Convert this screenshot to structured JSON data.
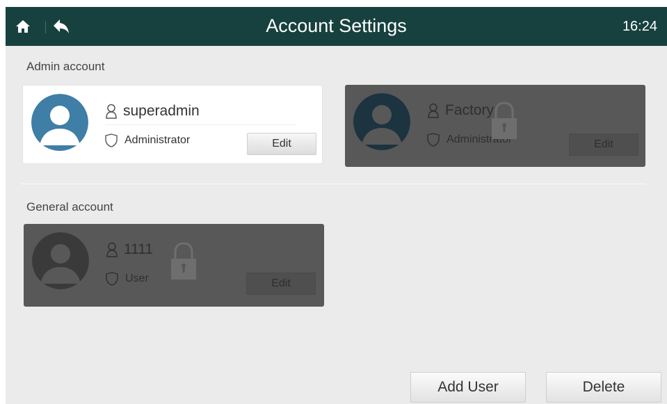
{
  "header": {
    "title": "Account Settings",
    "time": "16:24",
    "home_icon": "home-icon",
    "back_icon": "back-arrow-icon",
    "color": "#17413f"
  },
  "sections": {
    "admin_label": "Admin account",
    "general_label": "General account"
  },
  "admin_accounts": [
    {
      "name": "superadmin",
      "role": "Administrator",
      "edit_label": "Edit",
      "locked": false
    },
    {
      "name": "Factory",
      "role": "Administrator",
      "edit_label": "Edit",
      "locked": true
    }
  ],
  "general_accounts": [
    {
      "name": "1111",
      "role": "User",
      "edit_label": "Edit",
      "locked": true
    }
  ],
  "actions": {
    "add_user": "Add User",
    "delete": "Delete"
  },
  "colors": {
    "avatar_active": "#3f7ea6",
    "avatar_locked": "#1c3340",
    "card_locked": "#585858",
    "background": "#ebebeb"
  }
}
